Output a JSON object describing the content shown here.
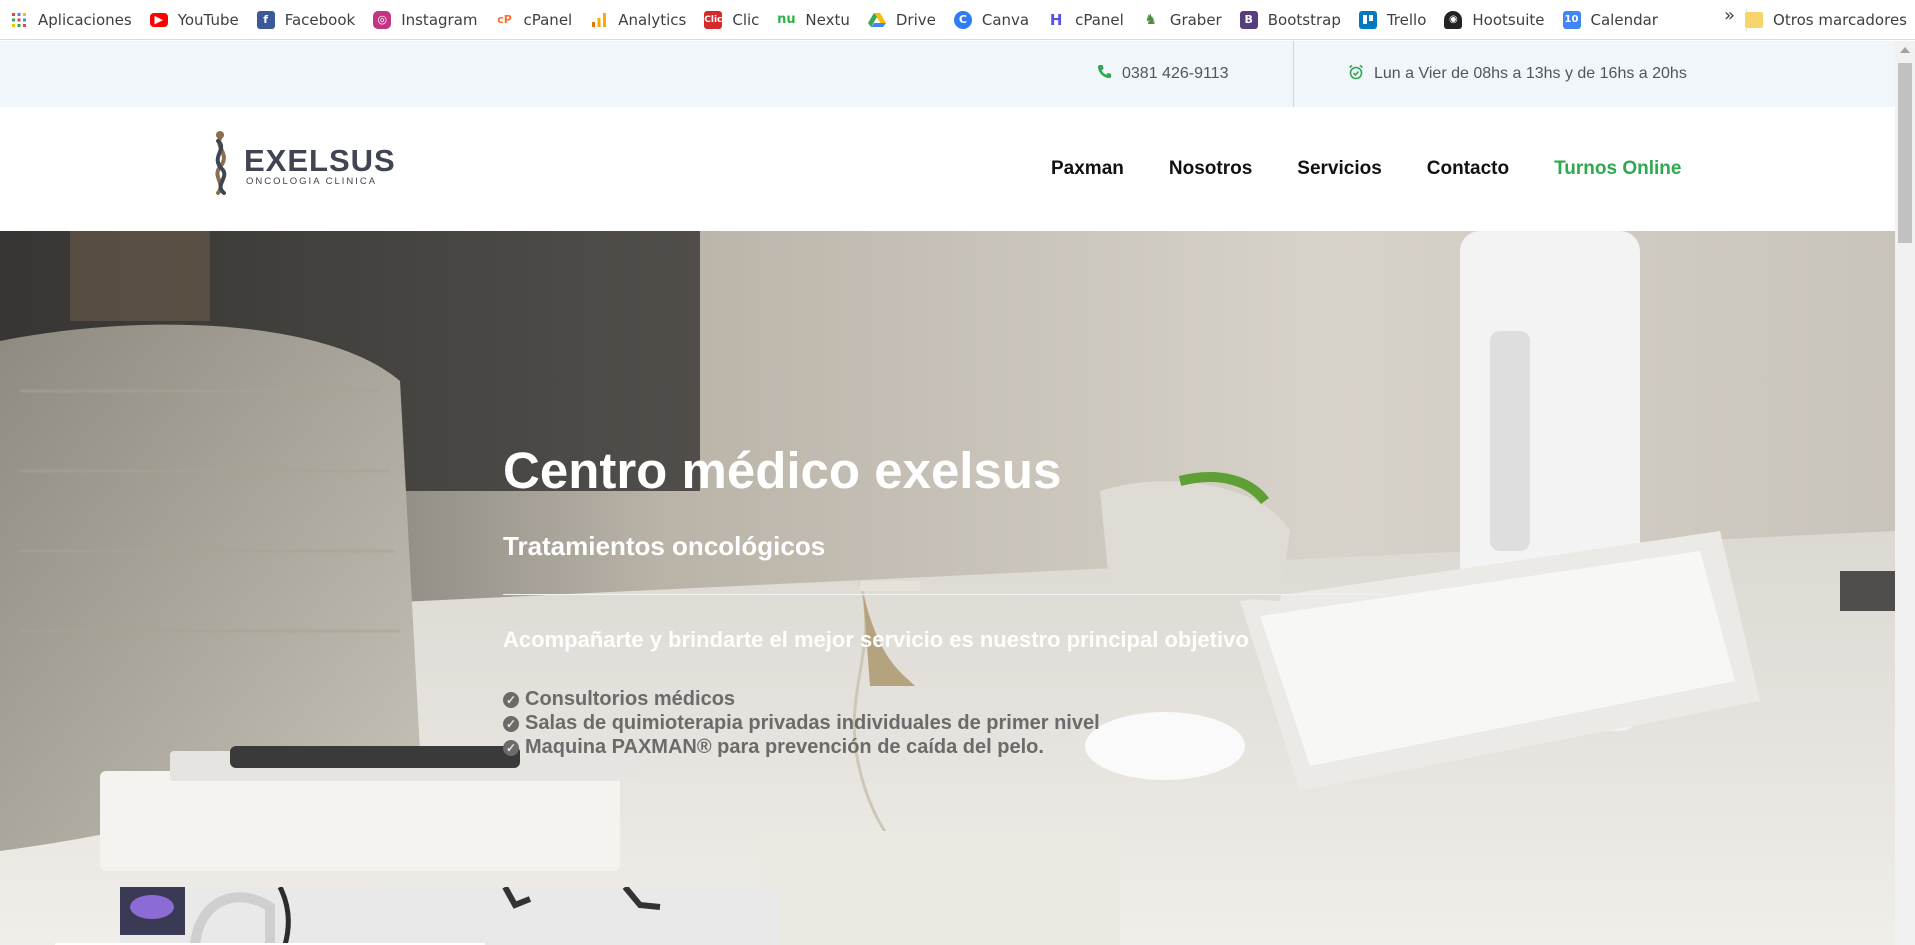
{
  "bookmarks": [
    {
      "label": "Aplicaciones",
      "icon": "apps-grid-icon",
      "color": "#ea4335"
    },
    {
      "label": "YouTube",
      "icon": "youtube-icon",
      "color": "#ff0000"
    },
    {
      "label": "Facebook",
      "icon": "facebook-icon",
      "color": "#3b5998"
    },
    {
      "label": "Instagram",
      "icon": "instagram-icon",
      "color": "#c13584"
    },
    {
      "label": "cPanel",
      "icon": "cpanel-icon",
      "color": "#ff6c2c"
    },
    {
      "label": "Analytics",
      "icon": "analytics-icon",
      "color": "#f9ab00"
    },
    {
      "label": "Clic",
      "icon": "clic-icon",
      "color": "#d42a2a"
    },
    {
      "label": "Nextu",
      "icon": "nextu-icon",
      "color": "#2db34a"
    },
    {
      "label": "Drive",
      "icon": "drive-icon",
      "color": "#34a853"
    },
    {
      "label": "Canva",
      "icon": "canva-icon",
      "color": "#2f7cf6"
    },
    {
      "label": "cPanel",
      "icon": "cpanel-h-icon",
      "color": "#5b50e6"
    },
    {
      "label": "Graber",
      "icon": "graber-icon",
      "color": "#4c8a3c"
    },
    {
      "label": "Bootstrap",
      "icon": "bootstrap-icon",
      "color": "#563d7c"
    },
    {
      "label": "Trello",
      "icon": "trello-icon",
      "color": "#0079bf"
    },
    {
      "label": "Hootsuite",
      "icon": "hootsuite-icon",
      "color": "#222222"
    },
    {
      "label": "Calendar",
      "icon": "calendar-icon",
      "color": "#4285f4"
    }
  ],
  "bookmarks_more": "»",
  "other_bookmarks": "Otros marcadores",
  "topbar": {
    "phone": "0381 426-9113",
    "hours": "Lun a Vier de 08hs a 13hs y de 16hs a 20hs"
  },
  "logo": {
    "name": "EXELSUS",
    "tagline": "ONCOLOGIA CLINICA"
  },
  "nav": [
    "Paxman",
    "Nosotros",
    "Servicios",
    "Contacto",
    "Turnos Online"
  ],
  "hero": {
    "title": "Centro médico exelsus",
    "subtitle": "Tratamientos oncológicos",
    "tagline": "Acompañarte y brindarte el mejor servicio es nuestro principal objetivo",
    "features": [
      "Consultorios médicos",
      "Salas de quimioterapia privadas individuales de primer nivel",
      "Maquina PAXMAN® para prevención de caída del pelo."
    ]
  },
  "colors": {
    "accent": "#2fa84f",
    "topbar_bg": "#f1f6fb"
  }
}
